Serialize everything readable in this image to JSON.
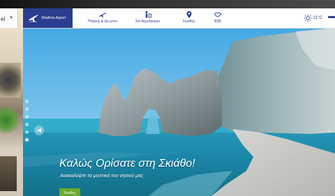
{
  "language": {
    "current": "el"
  },
  "header": {
    "logo_text": "Skiathos Airport",
    "nav": [
      {
        "label": "Πτήσεις & όχι μόνο",
        "icon": "airplane-icon"
      },
      {
        "label": "Στο Αεροδρόμιο",
        "icon": "travellers-icon"
      },
      {
        "label": "Σκιάθος",
        "icon": "map-pin-icon"
      },
      {
        "label": "B2B",
        "icon": "handshake-icon"
      }
    ],
    "weather": {
      "temp": "21°C",
      "icon": "sun-icon"
    }
  },
  "hero": {
    "title": "Καλώς Ορίσατε στη Σκιάθο!",
    "subtitle": "Ανακαλύψτε τα μυστικά του νησιού μας",
    "button_label": "Σκιάθος",
    "slides_count": 6,
    "active_slide": 6
  },
  "colors": {
    "brand": "#2b3e8f",
    "cta": "#6aaa2a"
  }
}
